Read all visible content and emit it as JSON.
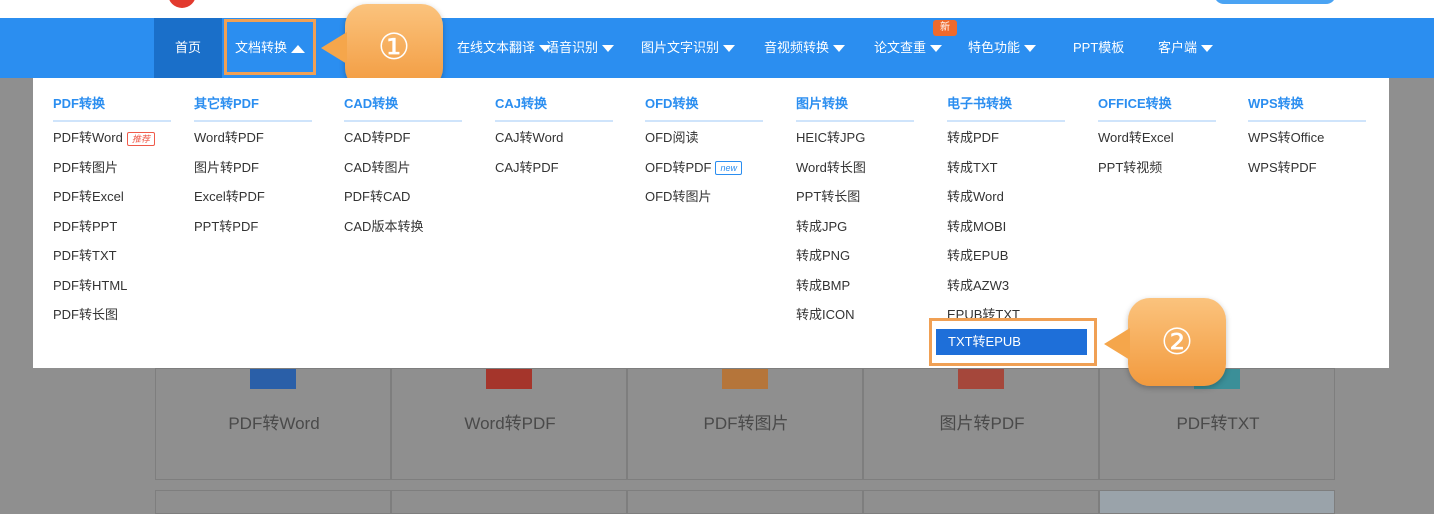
{
  "nav": {
    "home": "首页",
    "active": "文档转换",
    "hidden_partial": "在线文本翻译",
    "speech": "语音识别",
    "ocr": "图片文字识别",
    "av": "音视频转换",
    "paper": "论文查重",
    "paper_badge": "新",
    "special": "特色功能",
    "ppt": "PPT模板",
    "client": "客户端"
  },
  "callouts": {
    "one": "①",
    "two": "②"
  },
  "dropdown": {
    "columns": [
      {
        "title": "PDF转换",
        "items": [
          "PDF转Word",
          "PDF转图片",
          "PDF转Excel",
          "PDF转PPT",
          "PDF转TXT",
          "PDF转HTML",
          "PDF转长图"
        ]
      },
      {
        "title": "其它转PDF",
        "items": [
          "Word转PDF",
          "图片转PDF",
          "Excel转PDF",
          "PPT转PDF"
        ]
      },
      {
        "title": "CAD转换",
        "items": [
          "CAD转PDF",
          "CAD转图片",
          "PDF转CAD",
          "CAD版本转换"
        ]
      },
      {
        "title": "CAJ转换",
        "items": [
          "CAJ转Word",
          "CAJ转PDF"
        ]
      },
      {
        "title": "OFD转换",
        "items": [
          "OFD阅读",
          "OFD转PDF",
          "OFD转图片"
        ]
      },
      {
        "title": "图片转换",
        "items": [
          "HEIC转JPG",
          "Word转长图",
          "PPT转长图",
          "转成JPG",
          "转成PNG",
          "转成BMP",
          "转成ICON"
        ]
      },
      {
        "title": "电子书转换",
        "items": [
          "转成PDF",
          "转成TXT",
          "转成Word",
          "转成MOBI",
          "转成EPUB",
          "转成AZW3",
          "EPUB转TXT"
        ]
      },
      {
        "title": "OFFICE转换",
        "items": [
          "Word转Excel",
          "PPT转视频"
        ]
      },
      {
        "title": "WPS转换",
        "items": [
          "WPS转Office",
          "WPS转PDF"
        ]
      }
    ],
    "tag_hot": "推荐",
    "tag_new": "new",
    "highlighted": "TXT转EPUB"
  },
  "cards": [
    "PDF转Word",
    "Word转PDF",
    "PDF转图片",
    "图片转PDF",
    "PDF转TXT"
  ],
  "colors": {
    "nav_blue": "#2b8ef0",
    "callout_orange": "#f29a3e",
    "highlight_blue": "#1e6fd9"
  }
}
